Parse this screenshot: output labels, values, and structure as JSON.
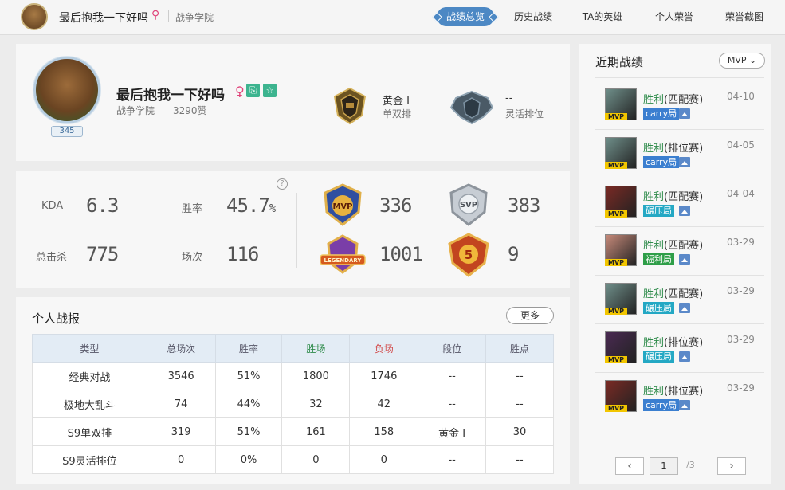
{
  "topbar": {
    "name": "最后抱我一下好吗",
    "gender": "♀",
    "server": "战争学院",
    "nav": [
      "战绩总览",
      "历史战绩",
      "TA的英雄",
      "个人荣誉",
      "荣誉截图"
    ],
    "active_nav": "战绩总览"
  },
  "profile": {
    "name": "最后抱我一下好吗",
    "gender": "♀",
    "level": "345",
    "server": "战争学院",
    "likes": "3290赞",
    "solo_rank": {
      "title": "黄金 Ⅰ",
      "sub": "单双排"
    },
    "flex_rank": {
      "title": "--",
      "sub": "灵活排位"
    }
  },
  "stats": {
    "kda_label": "KDA",
    "kda": "6.3",
    "winrate_label": "胜率",
    "winrate": "45.7",
    "winrate_unit": "%",
    "kills_label": "总击杀",
    "kills": "775",
    "games_label": "场次",
    "games": "116",
    "help": "?",
    "honors": [
      {
        "icon": "mvp-badge-icon",
        "text": "MVP",
        "value": "336"
      },
      {
        "icon": "svp-badge-icon",
        "text": "SVP",
        "value": "383"
      },
      {
        "icon": "legendary-badge-icon",
        "text": "LEGENDARY",
        "value": "1001"
      },
      {
        "icon": "pentakill-badge-icon",
        "text": "5",
        "value": "9"
      }
    ]
  },
  "report": {
    "title": "个人战报",
    "more": "更多",
    "headers": [
      "类型",
      "总场次",
      "胜率",
      "胜场",
      "负场",
      "段位",
      "胜点"
    ],
    "rows": [
      [
        "经典对战",
        "3546",
        "51%",
        "1800",
        "1746",
        "--",
        "--"
      ],
      [
        "极地大乱斗",
        "74",
        "44%",
        "32",
        "42",
        "--",
        "--"
      ],
      [
        "S9单双排",
        "319",
        "51%",
        "161",
        "158",
        "黄金 Ⅰ",
        "30"
      ],
      [
        "S9灵活排位",
        "0",
        "0%",
        "0",
        "0",
        "--",
        "--"
      ]
    ]
  },
  "recent": {
    "title": "近期战绩",
    "filter": "MVP",
    "matches": [
      {
        "result": "胜利",
        "mode": "(匹配赛)",
        "date": "04-10",
        "tag": "carry局",
        "tag_color": "#3b7fd0",
        "hero_color": "#6f8f8a"
      },
      {
        "result": "胜利",
        "mode": "(排位赛)",
        "date": "04-05",
        "tag": "carry局",
        "tag_color": "#3b7fd0",
        "hero_color": "#6f8f8a"
      },
      {
        "result": "胜利",
        "mode": "(匹配赛)",
        "date": "04-04",
        "tag": "碾压局",
        "tag_color": "#24a8c4",
        "hero_color": "#7a2a24"
      },
      {
        "result": "胜利",
        "mode": "(匹配赛)",
        "date": "03-29",
        "tag": "福利局",
        "tag_color": "#2e9e48",
        "hero_color": "#c78a7a"
      },
      {
        "result": "胜利",
        "mode": "(匹配赛)",
        "date": "03-29",
        "tag": "碾压局",
        "tag_color": "#24a8c4",
        "hero_color": "#6f8f8a"
      },
      {
        "result": "胜利",
        "mode": "(排位赛)",
        "date": "03-29",
        "tag": "碾压局",
        "tag_color": "#24a8c4",
        "hero_color": "#4a2a52"
      },
      {
        "result": "胜利",
        "mode": "(排位赛)",
        "date": "03-29",
        "tag": "carry局",
        "tag_color": "#3b7fd0",
        "hero_color": "#7a2a24"
      }
    ],
    "mvp_tag": "MVP",
    "pager": {
      "prev": "‹",
      "current": "1",
      "total": "/3",
      "next": "›"
    }
  }
}
